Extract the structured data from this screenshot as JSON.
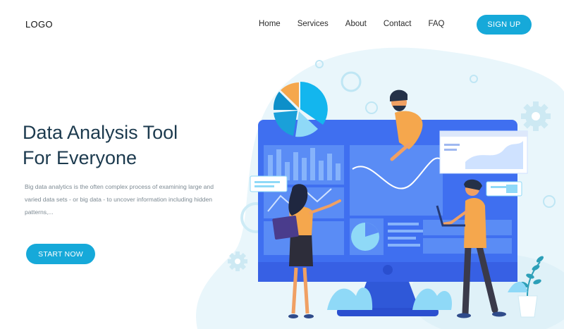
{
  "header": {
    "logo": "LOGO",
    "nav": [
      "Home",
      "Services",
      "About",
      "Contact",
      "FAQ"
    ],
    "signup": "SIGN UP"
  },
  "hero": {
    "title_line1": "Data Analysis Tool",
    "title_line2": "For Everyone",
    "description": "Big data analytics is the often complex process of examining large and varied data sets - or big data - to uncover information including hidden patterns,...",
    "cta": "START NOW"
  },
  "colors": {
    "accent": "#16a9d9",
    "monitor": "#3f6ff0",
    "skin": "#f0a063",
    "bg_blob": "#e9f6fb"
  },
  "illustration": {
    "icons": [
      "pie-chart",
      "gear",
      "monitor",
      "person-woman",
      "person-man-laptop",
      "person-man-pointing",
      "plant"
    ]
  }
}
